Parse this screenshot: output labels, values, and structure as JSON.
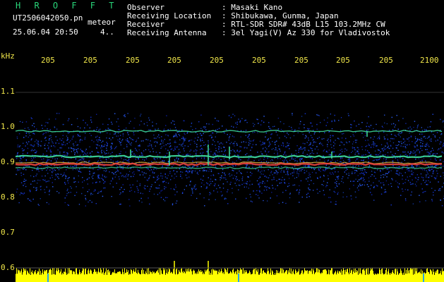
{
  "app": {
    "title": "H R O F F T",
    "filename": "UT2506042050.pn",
    "mode": "meteor",
    "datetime": "25.06.04 20:50",
    "count": "4.."
  },
  "info": [
    {
      "label": "Observer",
      "value": ": Masaki Kano"
    },
    {
      "label": "Receiving Location",
      "value": ": Shibukawa, Gunma, Japan"
    },
    {
      "label": "Receiver",
      "value": ": RTL-SDR SDR# 43dB L15 103.2MHz CW"
    },
    {
      "label": "Receiving Antenna",
      "value": ": 3el Yagi(V) Az 330 for Vladivostok"
    }
  ],
  "axis": {
    "unit": "kHz",
    "time_ticks": [
      "205",
      "205",
      "205",
      "205",
      "205",
      "205",
      "205",
      "205",
      "205",
      "2100"
    ],
    "freq_ticks": [
      "1.1",
      "1.0",
      "0.9",
      "0.8",
      "0.7",
      "0.6"
    ]
  },
  "colors": {
    "background": "#000000",
    "axis_text": "#f1e74a",
    "title": "#29d67a",
    "signal_hot": "#e8433b",
    "signal_mid": "#3fe0a0",
    "noise": "#1d3bd6",
    "bar": "#ffff00"
  }
}
